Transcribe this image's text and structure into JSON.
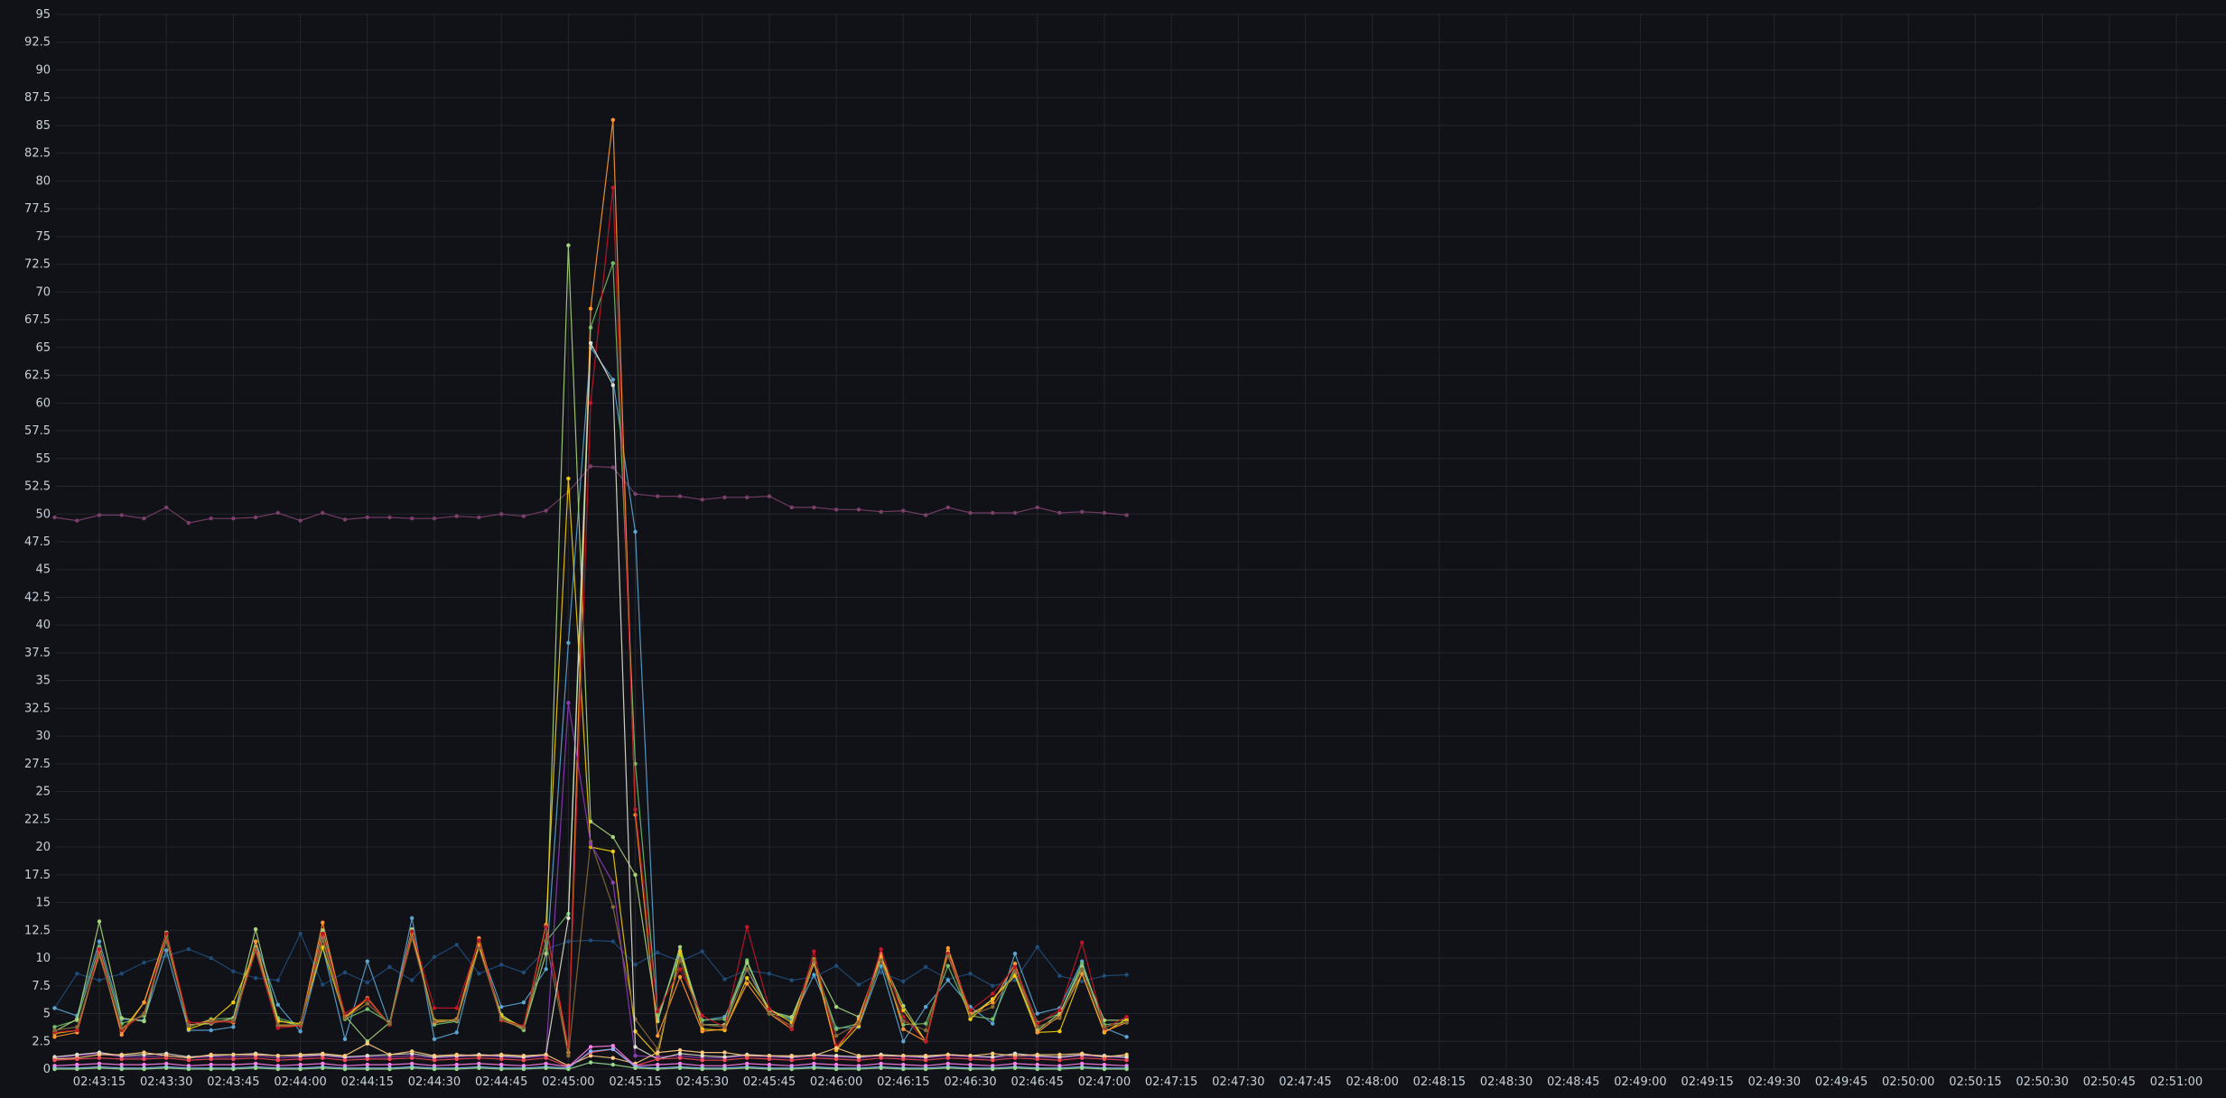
{
  "chart_data": {
    "type": "line",
    "theme": {
      "background": "#111217",
      "grid": "#24262c",
      "tick_text": "#c7d0d9"
    },
    "title": "",
    "xlabel": "",
    "ylabel": "",
    "ylim": [
      0,
      95
    ],
    "y_ticks": [
      "0",
      "2.5",
      "5",
      "7.5",
      "10",
      "12.5",
      "15",
      "17.5",
      "20",
      "22.5",
      "25",
      "27.5",
      "30",
      "32.5",
      "35",
      "37.5",
      "40",
      "42.5",
      "45",
      "47.5",
      "50",
      "52.5",
      "55",
      "57.5",
      "60",
      "62.5",
      "65",
      "67.5",
      "70",
      "72.5",
      "75",
      "77.5",
      "80",
      "82.5",
      "85",
      "87.5",
      "90",
      "92.5",
      "95"
    ],
    "x_start": "02:43:05",
    "x_step_seconds": 5,
    "x_ticks": [
      "02:43:15",
      "02:43:30",
      "02:43:45",
      "02:44:00",
      "02:44:15",
      "02:44:30",
      "02:44:45",
      "02:45:00",
      "02:45:15",
      "02:45:30",
      "02:45:45",
      "02:46:00",
      "02:46:15",
      "02:46:30",
      "02:46:45",
      "02:47:00",
      "02:47:15",
      "02:47:30",
      "02:47:45",
      "02:48:00",
      "02:48:15",
      "02:48:30",
      "02:48:45",
      "02:49:00",
      "02:49:15",
      "02:49:30",
      "02:49:45",
      "02:50:00",
      "02:50:15",
      "02:50:30",
      "02:50:45",
      "02:51:00"
    ],
    "grid": true,
    "legend": "none",
    "series": [
      {
        "color": "#7a3f6a",
        "values": [
          49.7,
          49.4,
          49.9,
          49.9,
          49.6,
          50.6,
          49.2,
          49.6,
          49.6,
          49.7,
          50.1,
          49.4,
          50.1,
          49.5,
          49.7,
          49.7,
          49.6,
          49.6,
          49.8,
          49.7,
          50.0,
          49.8,
          50.3,
          52.0,
          54.3,
          54.2,
          51.8,
          51.6,
          51.6,
          51.3,
          51.5,
          51.5,
          51.6,
          50.6,
          50.6,
          50.4,
          50.4,
          50.2,
          50.3,
          49.9,
          50.6,
          50.1,
          50.1,
          50.1,
          50.6,
          50.1,
          50.2,
          50.1,
          49.9
        ]
      },
      {
        "color": "#1f4d7a",
        "values": [
          5.5,
          8.6,
          8.0,
          8.6,
          9.6,
          10.2,
          10.8,
          10.0,
          8.8,
          8.2,
          8.0,
          12.2,
          7.6,
          8.7,
          7.8,
          9.2,
          8.0,
          10.1,
          11.2,
          8.6,
          9.4,
          8.7,
          10.8,
          11.5,
          11.6,
          11.5,
          9.4,
          10.5,
          9.7,
          10.6,
          8.1,
          8.9,
          8.6,
          8.0,
          8.3,
          9.3,
          7.6,
          8.7,
          7.9,
          9.2,
          8.1,
          8.6,
          7.5,
          8.0,
          11.0,
          8.4,
          7.9,
          8.4,
          8.5
        ]
      },
      {
        "color": "#5ba4cf",
        "values": [
          5.5,
          4.8,
          11.5,
          4.5,
          4.4,
          10.7,
          3.5,
          3.5,
          3.8,
          11.5,
          5.8,
          3.4,
          11.0,
          2.7,
          9.7,
          4.0,
          13.6,
          2.7,
          3.3,
          11.2,
          5.6,
          6.0,
          9.0,
          38.4,
          65.0,
          62.1,
          48.4,
          4.5,
          10.7,
          4.4,
          4.7,
          9.0,
          5.4,
          4.4,
          8.5,
          3.7,
          3.8,
          9.3,
          2.5,
          5.6,
          8.0,
          5.6,
          4.1,
          10.4,
          5.0,
          5.5,
          9.7,
          3.7,
          2.9
        ]
      },
      {
        "color": "#73bf69",
        "values": [
          3.8,
          4.4,
          11.0,
          4.1,
          4.8,
          12.0,
          3.8,
          4.5,
          4.6,
          11.0,
          4.6,
          4.0,
          11.8,
          4.5,
          5.4,
          4.2,
          12.5,
          4.0,
          4.3,
          11.1,
          4.7,
          3.5,
          11.5,
          14.0,
          66.8,
          72.6,
          27.5,
          4.8,
          10.3,
          4.4,
          4.5,
          9.8,
          5.0,
          4.6,
          9.5,
          3.6,
          4.1,
          9.8,
          4.0,
          4.1,
          9.3,
          4.8,
          4.5,
          9.2,
          4.2,
          5.0,
          9.5,
          4.0,
          4.2
        ]
      },
      {
        "color": "#a7d47a",
        "values": [
          3.4,
          4.5,
          13.3,
          4.6,
          4.3,
          12.3,
          4.0,
          4.1,
          4.6,
          12.6,
          4.4,
          3.9,
          12.5,
          4.8,
          2.5,
          4.2,
          12.6,
          4.2,
          4.4,
          11.1,
          4.9,
          3.6,
          10.4,
          74.2,
          22.3,
          20.9,
          17.5,
          4.3,
          11.0,
          4.0,
          4.0,
          9.6,
          5.2,
          4.7,
          9.5,
          5.6,
          4.7,
          10.1,
          5.7,
          2.5,
          10.6,
          4.8,
          6.3,
          8.6,
          3.5,
          5.0,
          9.2,
          4.4,
          4.4
        ]
      },
      {
        "color": "#f2cc0c",
        "values": [
          3.2,
          3.5,
          10.6,
          3.4,
          6.0,
          12.2,
          3.6,
          4.3,
          6.0,
          10.7,
          4.3,
          4.1,
          11.0,
          4.6,
          6.3,
          4.0,
          12.2,
          4.4,
          4.4,
          11.2,
          4.7,
          3.8,
          12.9,
          53.2,
          20.0,
          19.6,
          3.4,
          1.2,
          10.6,
          3.6,
          3.5,
          8.2,
          5.4,
          4.2,
          9.9,
          1.7,
          3.9,
          9.9,
          5.3,
          2.5,
          10.5,
          4.5,
          6.3,
          8.4,
          3.3,
          3.4,
          8.6,
          3.3,
          4.5
        ]
      },
      {
        "color": "#ff9830",
        "values": [
          2.9,
          3.3,
          10.6,
          3.1,
          6.0,
          12.2,
          3.9,
          4.4,
          4.2,
          11.5,
          3.9,
          3.9,
          13.2,
          4.7,
          6.4,
          4.0,
          12.2,
          4.2,
          4.5,
          11.8,
          4.4,
          3.7,
          13.0,
          1.5,
          68.5,
          85.5,
          22.9,
          3.0,
          8.3,
          3.4,
          3.6,
          7.7,
          5.0,
          3.6,
          9.6,
          1.8,
          4.5,
          10.4,
          3.6,
          2.5,
          10.9,
          5.0,
          6.0,
          9.5,
          3.3,
          4.8,
          8.6,
          3.4,
          4.2
        ]
      },
      {
        "color": "#c4162a",
        "values": [
          3.3,
          3.5,
          10.8,
          3.5,
          5.0,
          12.2,
          4.2,
          4.2,
          4.3,
          10.6,
          3.7,
          3.9,
          12.2,
          5.0,
          6.3,
          4.0,
          12.4,
          5.5,
          5.5,
          11.6,
          4.4,
          3.9,
          12.8,
          2.0,
          60.0,
          79.4,
          23.4,
          5.2,
          9.0,
          4.8,
          3.8,
          12.8,
          5.4,
          3.6,
          10.6,
          2.1,
          4.1,
          10.8,
          4.7,
          2.5,
          10.4,
          5.3,
          6.8,
          9.2,
          4.1,
          5.3,
          11.4,
          3.7,
          4.7
        ]
      },
      {
        "color": "#8a6a3a",
        "values": [
          3.5,
          3.8,
          10.2,
          3.7,
          5.0,
          11.5,
          3.9,
          4.3,
          4.4,
          10.8,
          4.0,
          4.0,
          11.6,
          4.6,
          5.9,
          4.1,
          11.8,
          4.3,
          4.4,
          10.9,
          4.5,
          3.7,
          11.6,
          1.2,
          20.5,
          14.6,
          4.5,
          1.8,
          9.8,
          4.0,
          3.8,
          9.0,
          5.0,
          3.9,
          9.8,
          3.0,
          4.1,
          9.8,
          4.3,
          3.5,
          10.2,
          4.8,
          5.6,
          8.8,
          3.8,
          4.6,
          9.0,
          3.8,
          4.2
        ]
      },
      {
        "color": "#8f3bb8",
        "values": [
          1.0,
          1.2,
          1.4,
          1.1,
          1.1,
          1.2,
          1.0,
          1.1,
          1.1,
          1.2,
          1.0,
          1.1,
          1.2,
          1.0,
          1.1,
          1.1,
          1.2,
          1.0,
          1.1,
          1.2,
          1.1,
          1.0,
          1.2,
          33.0,
          20.3,
          16.8,
          1.2,
          1.1,
          1.2,
          1.0,
          1.0,
          1.2,
          1.1,
          1.0,
          1.2,
          1.1,
          1.0,
          1.2,
          1.1,
          1.0,
          1.2,
          1.1,
          1.0,
          1.2,
          1.1,
          1.0,
          1.2,
          1.1,
          1.0
        ]
      },
      {
        "color": "#e0e0d0",
        "values": [
          1.1,
          1.3,
          1.5,
          1.2,
          1.3,
          1.4,
          1.1,
          1.2,
          1.3,
          1.4,
          1.2,
          1.2,
          1.3,
          1.1,
          1.2,
          1.3,
          1.4,
          1.1,
          1.2,
          1.3,
          1.2,
          1.1,
          1.3,
          13.6,
          65.4,
          61.6,
          2.0,
          0.9,
          1.4,
          1.2,
          1.1,
          1.3,
          1.2,
          1.1,
          1.3,
          1.2,
          1.1,
          1.3,
          1.2,
          1.1,
          1.3,
          1.2,
          1.1,
          1.4,
          1.2,
          1.1,
          1.3,
          1.2,
          1.1
        ]
      },
      {
        "color": "#ffcb7d",
        "values": [
          0.9,
          1.0,
          1.3,
          1.3,
          1.5,
          1.2,
          1.0,
          1.3,
          1.3,
          1.3,
          1.2,
          1.3,
          1.4,
          1.2,
          2.3,
          1.3,
          1.6,
          1.2,
          1.3,
          1.2,
          1.3,
          1.2,
          1.3,
          0.3,
          1.2,
          1.0,
          0.5,
          1.5,
          1.7,
          1.5,
          1.5,
          1.2,
          1.2,
          1.2,
          1.2,
          1.9,
          1.2,
          1.2,
          1.2,
          1.2,
          1.3,
          1.2,
          1.4,
          1.2,
          1.3,
          1.3,
          1.4,
          1.1,
          1.3
        ]
      },
      {
        "color": "#f2495c",
        "values": [
          0.8,
          0.9,
          1.0,
          0.9,
          0.9,
          1.0,
          0.8,
          0.9,
          0.9,
          1.0,
          0.8,
          0.9,
          1.0,
          0.8,
          0.9,
          0.9,
          1.0,
          0.8,
          0.9,
          1.0,
          0.9,
          0.8,
          1.0,
          0.2,
          1.5,
          1.8,
          0.3,
          0.9,
          1.0,
          0.8,
          0.8,
          1.0,
          0.9,
          0.8,
          1.0,
          0.9,
          0.8,
          1.0,
          0.9,
          0.8,
          1.0,
          0.9,
          0.8,
          1.0,
          0.9,
          0.8,
          1.0,
          0.9,
          0.8
        ]
      },
      {
        "color": "#ff7eeb",
        "values": [
          0.3,
          0.4,
          0.5,
          0.4,
          0.4,
          0.5,
          0.3,
          0.4,
          0.4,
          0.5,
          0.3,
          0.4,
          0.5,
          0.3,
          0.4,
          0.4,
          0.5,
          0.3,
          0.4,
          0.5,
          0.4,
          0.3,
          0.5,
          0.2,
          2.0,
          2.1,
          0.3,
          0.4,
          0.5,
          0.3,
          0.3,
          0.5,
          0.4,
          0.3,
          0.5,
          0.4,
          0.3,
          0.5,
          0.4,
          0.3,
          0.5,
          0.4,
          0.3,
          0.5,
          0.4,
          0.3,
          0.5,
          0.4,
          0.3
        ]
      },
      {
        "color": "#8ab8ff",
        "values": [
          0.1,
          0.1,
          0.2,
          0.1,
          0.1,
          0.2,
          0.1,
          0.1,
          0.1,
          0.2,
          0.1,
          0.1,
          0.2,
          0.1,
          0.1,
          0.1,
          0.2,
          0.1,
          0.1,
          0.2,
          0.1,
          0.1,
          0.2,
          0.1,
          1.6,
          1.8,
          0.2,
          0.1,
          0.2,
          0.1,
          0.1,
          0.2,
          0.1,
          0.1,
          0.2,
          0.1,
          0.1,
          0.2,
          0.1,
          0.1,
          0.2,
          0.1,
          0.1,
          0.2,
          0.1,
          0.1,
          0.2,
          0.1,
          0.1
        ]
      },
      {
        "color": "#96d98d",
        "values": [
          0.0,
          0.0,
          0.1,
          0.0,
          0.0,
          0.1,
          0.0,
          0.0,
          0.0,
          0.1,
          0.0,
          0.0,
          0.1,
          0.0,
          0.0,
          0.0,
          0.1,
          0.0,
          0.0,
          0.1,
          0.0,
          0.0,
          0.1,
          0.0,
          0.6,
          0.4,
          0.1,
          0.0,
          0.1,
          0.0,
          0.0,
          0.1,
          0.0,
          0.0,
          0.1,
          0.0,
          0.0,
          0.1,
          0.0,
          0.0,
          0.1,
          0.0,
          0.0,
          0.1,
          0.0,
          0.0,
          0.1,
          0.0,
          0.0
        ]
      }
    ]
  }
}
